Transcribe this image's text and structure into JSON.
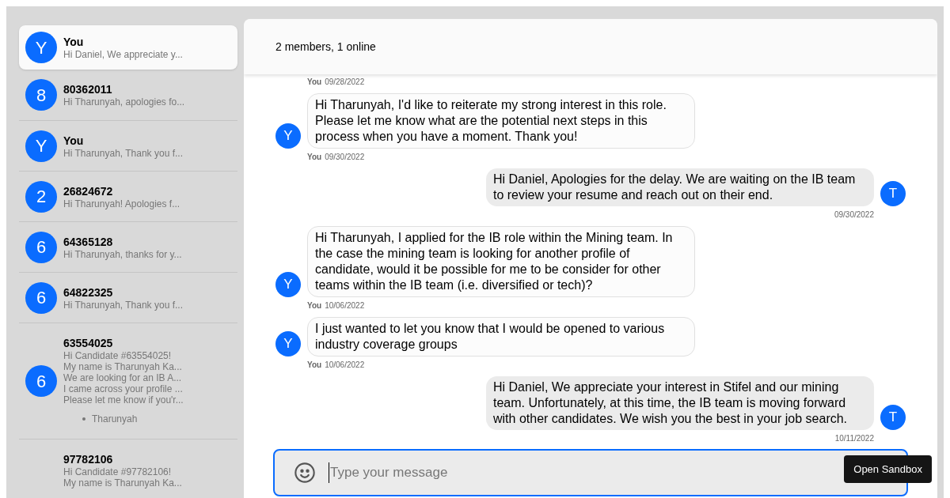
{
  "conversations": [
    {
      "avatar": "Y",
      "name": "You",
      "preview": [
        "Hi Daniel, We appreciate y..."
      ],
      "selected": true
    },
    {
      "avatar": "8",
      "name": "80362011",
      "preview": [
        "Hi Tharunyah, apologies fo..."
      ],
      "selected": false
    },
    {
      "avatar": "Y",
      "name": "You",
      "preview": [
        "Hi Tharunyah, Thank you f..."
      ],
      "selected": false
    },
    {
      "avatar": "2",
      "name": "26824672",
      "preview": [
        "Hi Tharunyah! Apologies f..."
      ],
      "selected": false
    },
    {
      "avatar": "6",
      "name": "64365128",
      "preview": [
        "Hi Tharunyah, thanks for y..."
      ],
      "selected": false
    },
    {
      "avatar": "6",
      "name": "64822325",
      "preview": [
        "Hi Tharunyah, Thank you f..."
      ],
      "selected": false
    },
    {
      "avatar": "6",
      "name": "63554025",
      "preview": [
        "Hi Candidate #63554025!",
        "My name is Tharunyah Ka...",
        "We are looking for an IB A...",
        "I came across your profile ...",
        "Please let me know if you'r..."
      ],
      "bullets": [
        "Tharunyah"
      ],
      "selected": false
    },
    {
      "name": "97782106",
      "preview": [
        "Hi Candidate #97782106!",
        "My name is Tharunyah Ka..."
      ],
      "selected": false
    }
  ],
  "header": {
    "status": "2 members, 1 online"
  },
  "earlier_caption": {
    "sender": "You",
    "date": "09/28/2022"
  },
  "messages": [
    {
      "kind": "received",
      "avatar": "Y",
      "text": "Hi Tharunyah, I'd like to reiterate my strong interest in this role. Please let me know what are the potential next steps in this process when you have a moment. Thank you!",
      "sender": "You",
      "date": "09/30/2022"
    },
    {
      "kind": "sent",
      "avatar": "T",
      "text": "Hi Daniel, Apologies for the delay. We are waiting on the IB team to review your resume and reach out on their end.",
      "date": "09/30/2022"
    },
    {
      "kind": "received",
      "avatar": "Y",
      "text": "Hi Tharunyah, I applied for the IB role within the Mining team. In the case the mining team is looking for another profile of candidate, would it be possible for me to be consider for other teams within the IB team (i.e. diversified or tech)?",
      "sender": "You",
      "date": "10/06/2022"
    },
    {
      "kind": "received",
      "avatar": "Y",
      "text": "I just wanted to let you know that I would be opened to various industry coverage groups",
      "sender": "You",
      "date": "10/06/2022"
    },
    {
      "kind": "sent",
      "avatar": "T",
      "text": "Hi Daniel, We appreciate your interest in Stifel and our mining team. Unfortunately, at this time, the IB team is moving forward with other candidates. We wish you the best in your job search.",
      "date": "10/11/2022"
    }
  ],
  "composer": {
    "placeholder": "Type your message"
  },
  "sandbox_button": "Open Sandbox"
}
